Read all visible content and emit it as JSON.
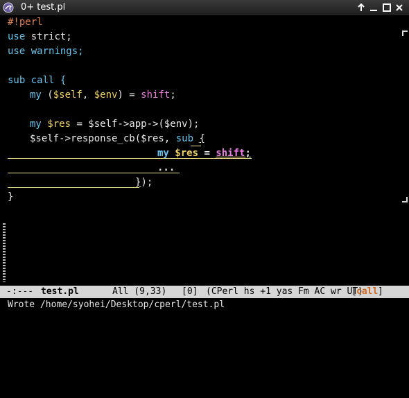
{
  "window": {
    "title": "0+ test.pl",
    "icon": "emacs-gnu-icon",
    "buttons": [
      "arrow-up-icon",
      "minimize-icon",
      "maximize-icon",
      "close-icon"
    ]
  },
  "code": {
    "line1": "#!perl",
    "line2_kw": "use",
    "line2_rest": " strict;",
    "line3_kw": "use",
    "line3_rest": " warnings;",
    "line5_kw": "sub",
    "line5_rest": " call {",
    "line6_kw": "my",
    "line6_a": " (",
    "line6_v1": "$self",
    "line6_b": ", ",
    "line6_v2": "$env",
    "line6_c": ") = ",
    "line6_fn": "shift",
    "line6_d": ";",
    "line8_kw": "my",
    "line8_sp": " ",
    "line8_v": "$res",
    "line8_rest": " = $self->app->($env);",
    "line9_a": "$self->response_cb($res, ",
    "line9_kw": "sub",
    "line9_sp": " ",
    "line9_brace": "{",
    "line10_kw": "my",
    "line10_sp": " ",
    "line10_v": "$res",
    "line10_eq": " = ",
    "line10_fn": "shift",
    "line10_end": ";",
    "line11": "...",
    "line12_close": "}",
    "line12_rest": ");",
    "line13": "}"
  },
  "modeline": {
    "status": "-:---",
    "buffer": "test.pl",
    "position": "All (9,33)",
    "depth": "[0]",
    "modes": "(CPerl hs +1 yas Fm AC wr UT)",
    "which_func_open": "[",
    "which_func": "call",
    "which_func_close": "]"
  },
  "echo": {
    "message": "Wrote /home/syohei/Desktop/cperl/test.pl"
  },
  "colors": {
    "keyword": "#67c6f0",
    "variable": "#f0d060",
    "function": "#e87ee0",
    "preprocessor": "#e0834f",
    "highlight_rule": "#f0e08a"
  }
}
